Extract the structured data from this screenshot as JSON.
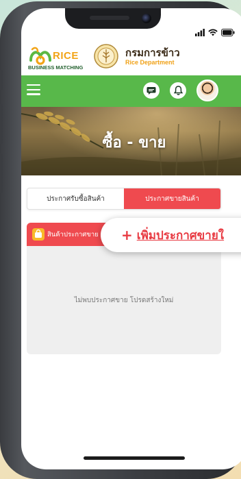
{
  "header": {
    "rice_logo_word": "RICE",
    "rice_logo_sub": "BUSINESS MATCHING",
    "dept_name_thai": "กรมการข้าว",
    "dept_name_en": "Rice Department"
  },
  "navbar": {
    "color": "#58b84a",
    "icons": [
      "menu-icon",
      "chat-icon",
      "bell-icon",
      "avatar"
    ]
  },
  "hero": {
    "title": "ซื้อ - ขาย"
  },
  "tabs": [
    {
      "label": "ประกาศรับซื้อสินค้า",
      "active": false
    },
    {
      "label": "ประกาศขายสินค้า",
      "active": true
    }
  ],
  "card": {
    "title": "สินค้าประกาศขาย",
    "empty_message": "ไม่พบประกาศขาย โปรดสร้างใหม่"
  },
  "add_button": {
    "plus": "+",
    "label": "เพิ่มประกาศขายใ"
  },
  "colors": {
    "accent_red": "#ef4a4f",
    "nav_green": "#58b84a",
    "logo_orange": "#f2a417"
  }
}
